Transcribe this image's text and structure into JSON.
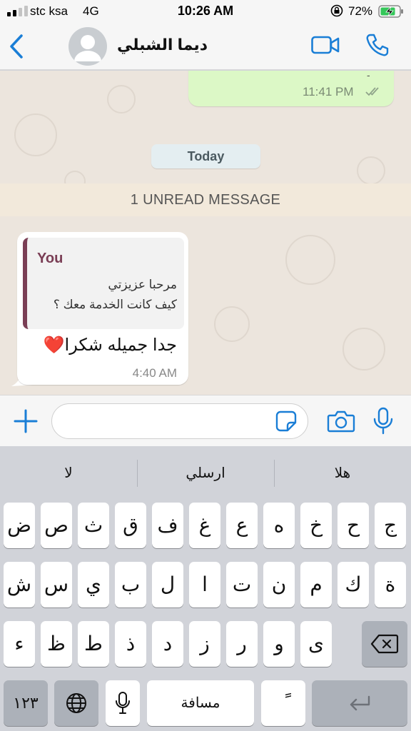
{
  "status_bar": {
    "carrier": "stc ksa",
    "network": "4G",
    "time": "10:26 AM",
    "battery_percent": "72%"
  },
  "header": {
    "contact_name": "ديما الشبلي"
  },
  "chat": {
    "outgoing": {
      "partial_text": "-",
      "time": "11:41 PM"
    },
    "date_separator": "Today",
    "unread_banner": "1 UNREAD MESSAGE",
    "incoming": {
      "quote_author": "You",
      "quote_line_1": "مرحبا عزيزتي",
      "quote_line_2": "كيف كانت الخدمة معك ؟",
      "text": "جدا جميله شكرا❤️",
      "time": "4:40 AM"
    }
  },
  "input": {
    "placeholder": ""
  },
  "keyboard": {
    "suggestions": [
      "لا",
      "ارسلي",
      "هلا"
    ],
    "row1": [
      "ض",
      "ص",
      "ث",
      "ق",
      "ف",
      "غ",
      "ع",
      "ه",
      "خ",
      "ح",
      "ج"
    ],
    "row2": [
      "ش",
      "س",
      "ي",
      "ب",
      "ل",
      "ا",
      "ت",
      "ن",
      "م",
      "ك",
      "ة"
    ],
    "row3": [
      "ء",
      "ظ",
      "ط",
      "ذ",
      "د",
      "ز",
      "ر",
      "و",
      "ى"
    ],
    "numbers_key": "١٢٣",
    "space_key": "مسافة",
    "diacritic_key": "ً",
    "icons": [
      "globe-icon",
      "mic-icon",
      "backspace-icon",
      "return-icon"
    ]
  },
  "colors": {
    "accent": "#1a7ed6",
    "outgoing_bubble": "#dcf8c6",
    "chat_background": "#ece5dd",
    "quote_bar": "#7a3e55"
  }
}
